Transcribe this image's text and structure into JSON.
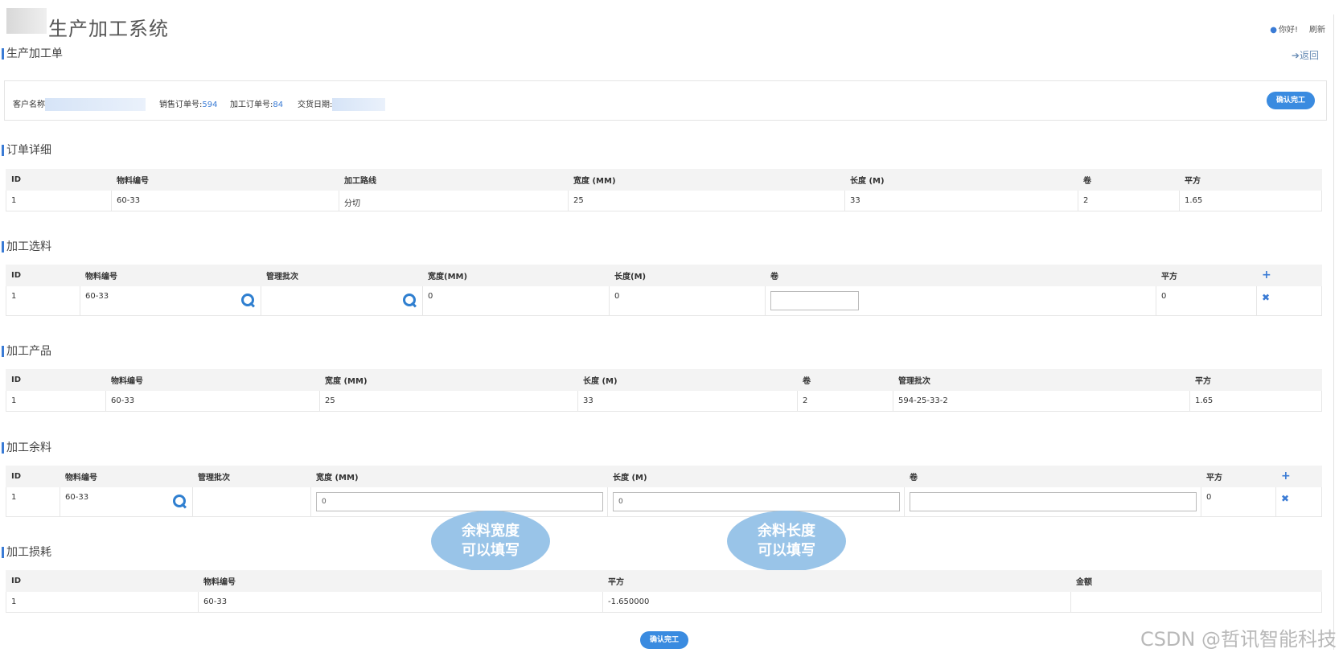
{
  "header": {
    "title": "生产加工系统",
    "greeting": "你好!",
    "refresh": "刷新"
  },
  "page": {
    "section_title": "生产加工单",
    "back_label": "返回"
  },
  "info": {
    "customer_label": "客户名称",
    "sales_order_label": "销售订单号:",
    "sales_order_value": "594",
    "process_order_label": "加工订单号:",
    "process_order_value": "84",
    "delivery_label": "交货日期:",
    "confirm_label": "确认完工"
  },
  "order_detail": {
    "title": "订单详细",
    "headers": [
      "ID",
      "物料编号",
      "加工路线",
      "宽度 (MM)",
      "长度 (M)",
      "卷",
      "平方"
    ],
    "rows": [
      [
        "1",
        "60-33",
        "分切",
        "25",
        "33",
        "2",
        "1.65"
      ]
    ]
  },
  "material_select": {
    "title": "加工选料",
    "headers": [
      "ID",
      "物料编号",
      "管理批次",
      "宽度(MM)",
      "长度(M)",
      "卷",
      "平方",
      "+"
    ],
    "rows": [
      [
        "1",
        "60-33",
        "",
        "0",
        "0",
        "",
        "0"
      ]
    ]
  },
  "products": {
    "title": "加工产品",
    "headers": [
      "ID",
      "物料编号",
      "宽度 (MM)",
      "长度 (M)",
      "卷",
      "管理批次",
      "平方"
    ],
    "rows": [
      [
        "1",
        "60-33",
        "25",
        "33",
        "2",
        "594-25-33-2",
        "1.65"
      ]
    ]
  },
  "remainder": {
    "title": "加工余料",
    "headers": [
      "ID",
      "物料编号",
      "管理批次",
      "宽度 (MM)",
      "长度 (M)",
      "卷",
      "平方",
      "+"
    ],
    "rows": [
      [
        "1",
        "60-33",
        "",
        "0",
        "0",
        "",
        "0"
      ]
    ]
  },
  "loss": {
    "title": "加工损耗",
    "headers": [
      "ID",
      "物料编号",
      "平方",
      "金额"
    ],
    "rows": [
      [
        "1",
        "60-33",
        "-1.650000",
        ""
      ]
    ]
  },
  "annotations": {
    "width_note_line1": "余料宽度",
    "width_note_line2": "可以填写",
    "length_note_line1": "余料长度",
    "length_note_line2": "可以填写"
  },
  "footer": {
    "confirm_label": "确认完工",
    "watermark": "CSDN @哲讯智能科技"
  },
  "colors": {
    "accent": "#3a8be0",
    "bubble": "#99c4e8"
  }
}
